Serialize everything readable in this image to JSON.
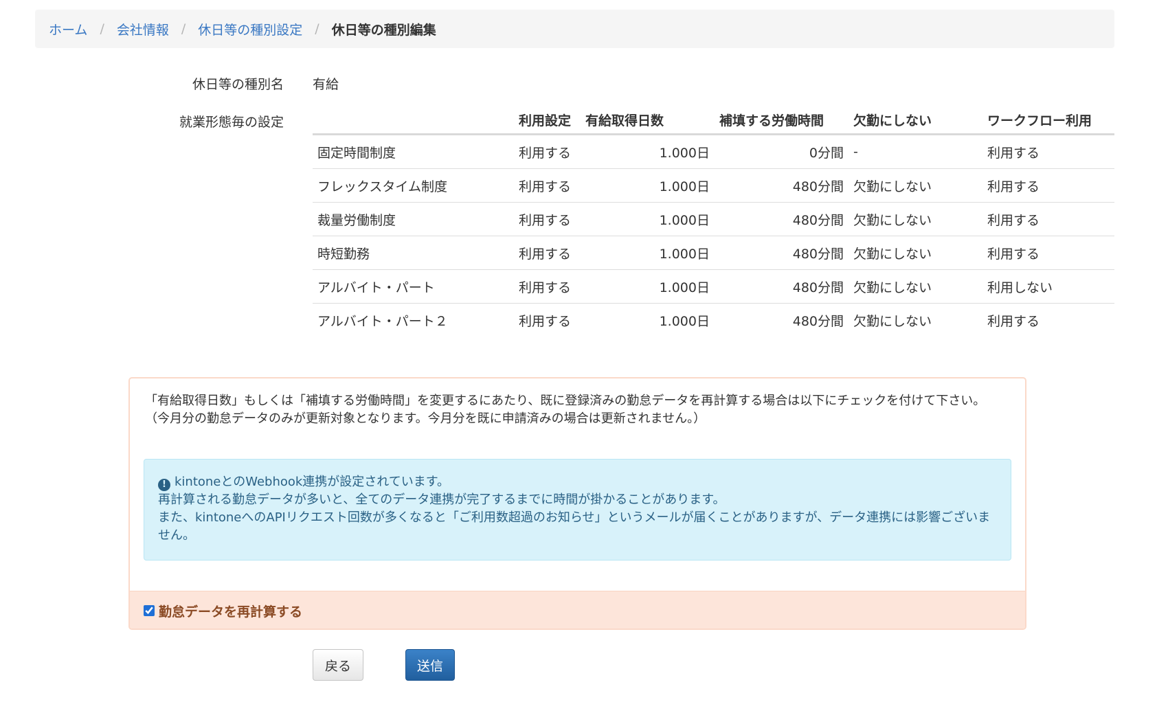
{
  "breadcrumb": {
    "home": "ホーム",
    "company": "会社情報",
    "holiday_types": "休日等の種別設定",
    "current": "休日等の種別編集",
    "separator": "/"
  },
  "form": {
    "type_name_label": "休日等の種別名",
    "type_name_value": "有給",
    "per_work_style_label": "就業形態毎の設定"
  },
  "table": {
    "headers": [
      "",
      "利用設定",
      "有給取得日数",
      "補填する労働時間",
      "欠勤にしない",
      "ワークフロー利用"
    ],
    "rows": [
      [
        "固定時間制度",
        "利用する",
        "1.000日",
        "0分間",
        "-",
        "利用する"
      ],
      [
        "フレックスタイム制度",
        "利用する",
        "1.000日",
        "480分間",
        "欠勤にしない",
        "利用する"
      ],
      [
        "裁量労働制度",
        "利用する",
        "1.000日",
        "480分間",
        "欠勤にしない",
        "利用する"
      ],
      [
        "時短勤務",
        "利用する",
        "1.000日",
        "480分間",
        "欠勤にしない",
        "利用する"
      ],
      [
        "アルバイト・パート",
        "利用する",
        "1.000日",
        "480分間",
        "欠勤にしない",
        "利用しない"
      ],
      [
        "アルバイト・パート２",
        "利用する",
        "1.000日",
        "480分間",
        "欠勤にしない",
        "利用する"
      ]
    ]
  },
  "warning": {
    "line1": "「有給取得日数」もしくは「補填する労働時間」を変更するにあたり、既に登録済みの勤怠データを再計算する場合は以下にチェックを付けて下さい。",
    "line2": "（今月分の勤怠データのみが更新対象となります。今月分を既に申請済みの場合は更新されません。）",
    "info_line1": "kintoneとのWebhook連携が設定されています。",
    "info_line2": "再計算される勤怠データが多いと、全てのデータ連携が完了するまでに時間が掛かることがあります。",
    "info_line3": "また、kintoneへのAPIリクエスト回数が多くなると「ご利用数超過のお知らせ」というメールが届くことがありますが、データ連携には影響ございません。",
    "info_icon": "!",
    "checkbox_label": "勤怠データを再計算する",
    "checkbox_checked": true
  },
  "buttons": {
    "back": "戻る",
    "submit": "送信"
  }
}
